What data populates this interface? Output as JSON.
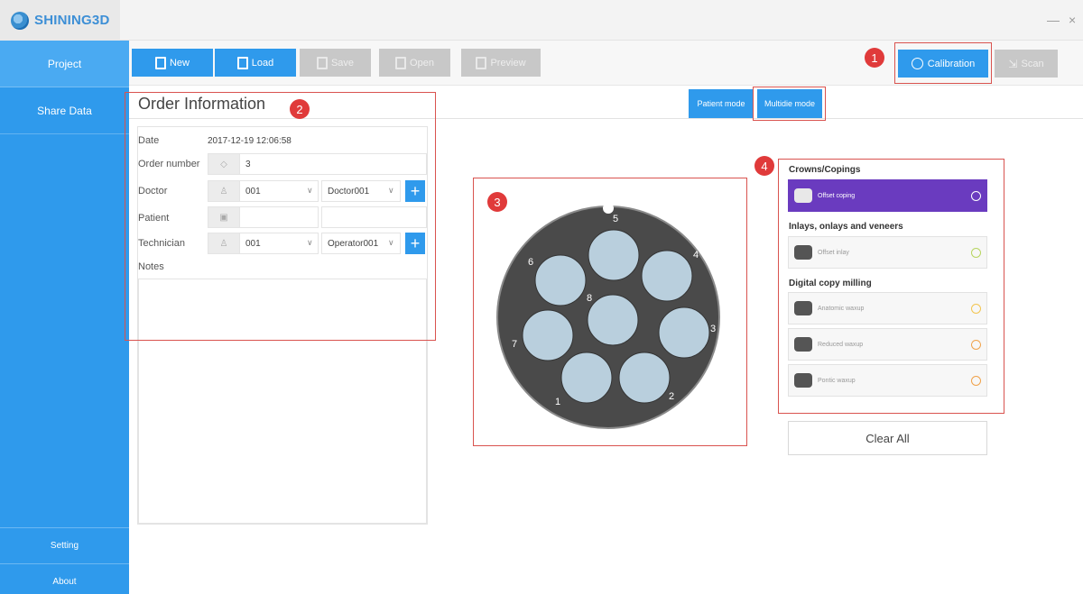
{
  "brand": {
    "name": "SHINING3D"
  },
  "window": {
    "minimize": "—",
    "close": "×"
  },
  "sidebar": {
    "items": [
      {
        "label": "Project"
      },
      {
        "label": "Share Data"
      }
    ],
    "bottom": [
      {
        "label": "Setting"
      },
      {
        "label": "About"
      }
    ]
  },
  "toolbar": {
    "new": "New",
    "load": "Load",
    "save": "Save",
    "open": "Open",
    "preview": "Preview",
    "calibration": "Calibration",
    "scan": "Scan"
  },
  "modes": {
    "patient": "Patient mode",
    "multidie": "Multidie mode"
  },
  "order": {
    "title": "Order Information",
    "date_label": "Date",
    "date_value": "2017-12-19 12:06:58",
    "order_number_label": "Order number",
    "order_number_value": "3",
    "doctor_label": "Doctor",
    "doctor_id": "001",
    "doctor_name": "Doctor001",
    "patient_label": "Patient",
    "patient_value": "",
    "patient_value2": "",
    "technician_label": "Technician",
    "technician_id": "001",
    "technician_name": "Operator001",
    "notes_label": "Notes"
  },
  "tray": {
    "slots": [
      "1",
      "2",
      "3",
      "4",
      "5",
      "6",
      "7",
      "8"
    ]
  },
  "materials": {
    "sections": [
      {
        "title": "Crowns/Copings",
        "items": [
          {
            "label": "Offset coping",
            "selected": true
          }
        ]
      },
      {
        "title": "Inlays, onlays and veneers",
        "items": [
          {
            "label": "Offset inlay"
          }
        ]
      },
      {
        "title": "Digital copy milling",
        "items": [
          {
            "label": "Anatomic waxup"
          },
          {
            "label": "Reduced waxup"
          },
          {
            "label": "Pontic waxup"
          }
        ]
      }
    ],
    "clear_all": "Clear All"
  },
  "callouts": [
    "1",
    "2",
    "3",
    "4"
  ],
  "colors": {
    "accent": "#2f9aec",
    "selected": "#6a3bbf",
    "callout": "#e03a3a",
    "tray": "#4a4a4a",
    "slot": "#b9cfdd"
  }
}
